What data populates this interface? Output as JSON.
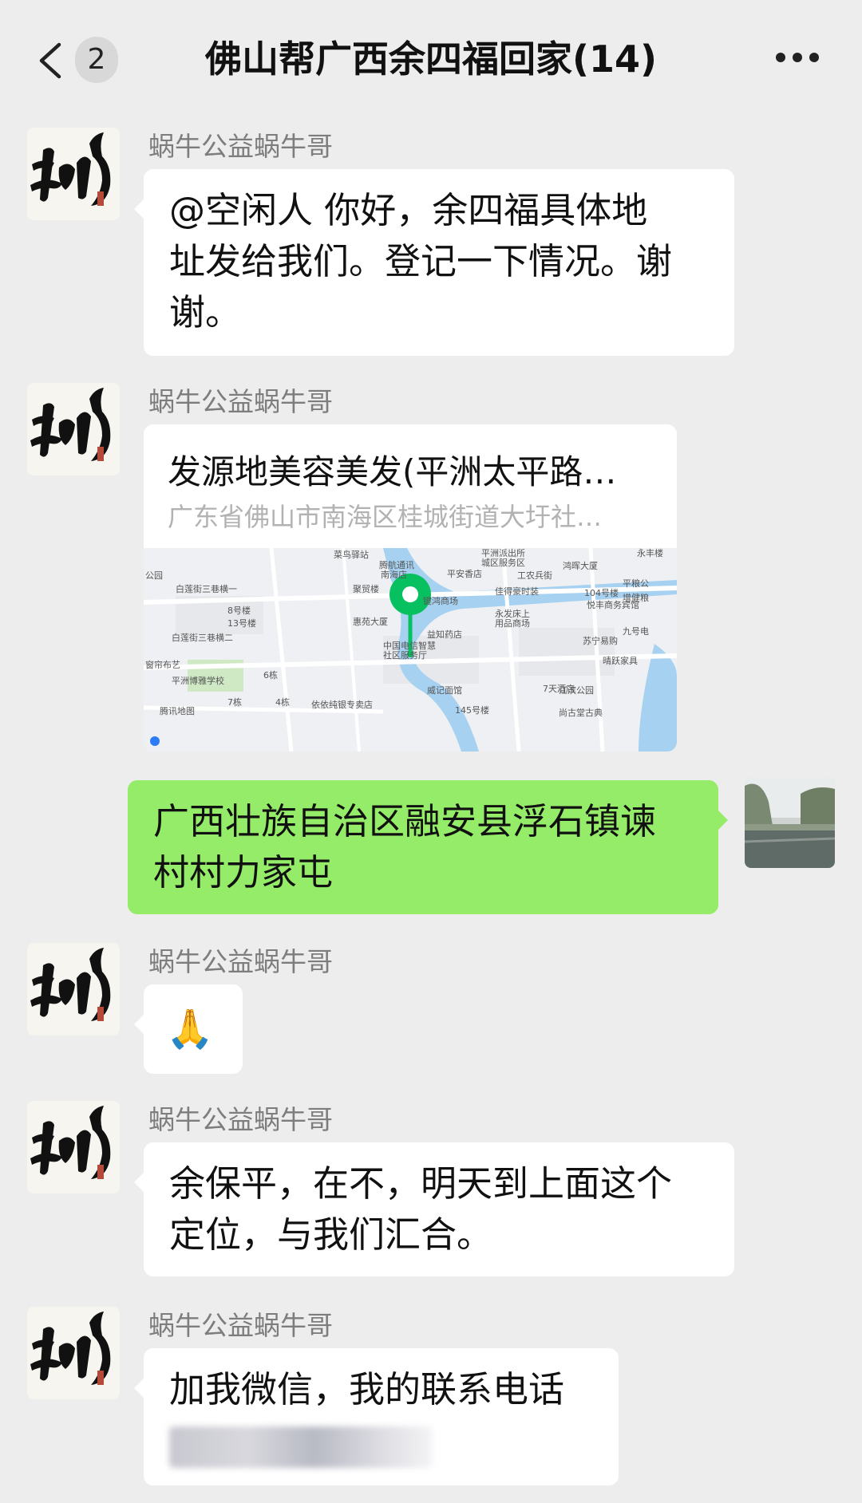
{
  "header": {
    "back_badge": "2",
    "title": "佛山帮广西余四福回家(14)"
  },
  "messages": [
    {
      "sender": "蜗牛公益蜗牛哥",
      "text_lines": [
        "@空闲人  你好，余四福具体地",
        "址发给我们。登记一下情况。谢",
        "谢。"
      ]
    },
    {
      "sender": "蜗牛公益蜗牛哥",
      "location": {
        "name": "发源地美容美发(平洲太平路…",
        "address": "广东省佛山市南海区桂城街道大圩社…",
        "map_labels": [
          "菜鸟驿站",
          "平洲派出所",
          "城区服务区",
          "永丰楼",
          "公园",
          "腾航通讯",
          "南海店",
          "平安香店",
          "工农兵街",
          "鸿晖大厦",
          "平粮公",
          "白莲街三巷横一",
          "聚贸楼",
          "佳得豪时装",
          "104号楼",
          "增健粮",
          "悦丰商务宾馆",
          "8号楼",
          "键鸿商场",
          "永发床上",
          "用品商场",
          "13号楼",
          "惠苑大厦",
          "益知药店",
          "九号电",
          "白莲街三巷横二",
          "苏宁易购",
          "中国电信智慧",
          "社区服务厅",
          "晴跃家具",
          "窗帘布艺",
          "6栋",
          "平洲博雅学校",
          "威记面馆",
          "7天酒店",
          "江滨公园",
          "腾讯地图",
          "7栋",
          "4栋",
          "依依纯银专卖店",
          "145号楼",
          "尚古堂古典"
        ]
      }
    },
    {
      "self": true,
      "text_lines": [
        "广西壮族自治区融安县浮石镇谏",
        "村村力家屯"
      ]
    },
    {
      "sender": "蜗牛公益蜗牛哥",
      "emoji": "🙏"
    },
    {
      "sender": "蜗牛公益蜗牛哥",
      "text_lines": [
        "余保平，在不，明天到上面这个",
        "定位，与我们汇合。"
      ]
    },
    {
      "sender": "蜗牛公益蜗牛哥",
      "text_lines": [
        "加我微信，我的联系电话"
      ]
    }
  ],
  "colors": {
    "background": "#ededed",
    "self_bubble": "#95ec69",
    "other_bubble": "#ffffff",
    "sender_name": "#7d7d7d",
    "map_pin": "#07c160"
  },
  "icons": {
    "back": "chevron-left-icon",
    "more": "more-dots-icon",
    "avatar": "calligraphy-avatar",
    "pin": "location-pin-icon"
  }
}
